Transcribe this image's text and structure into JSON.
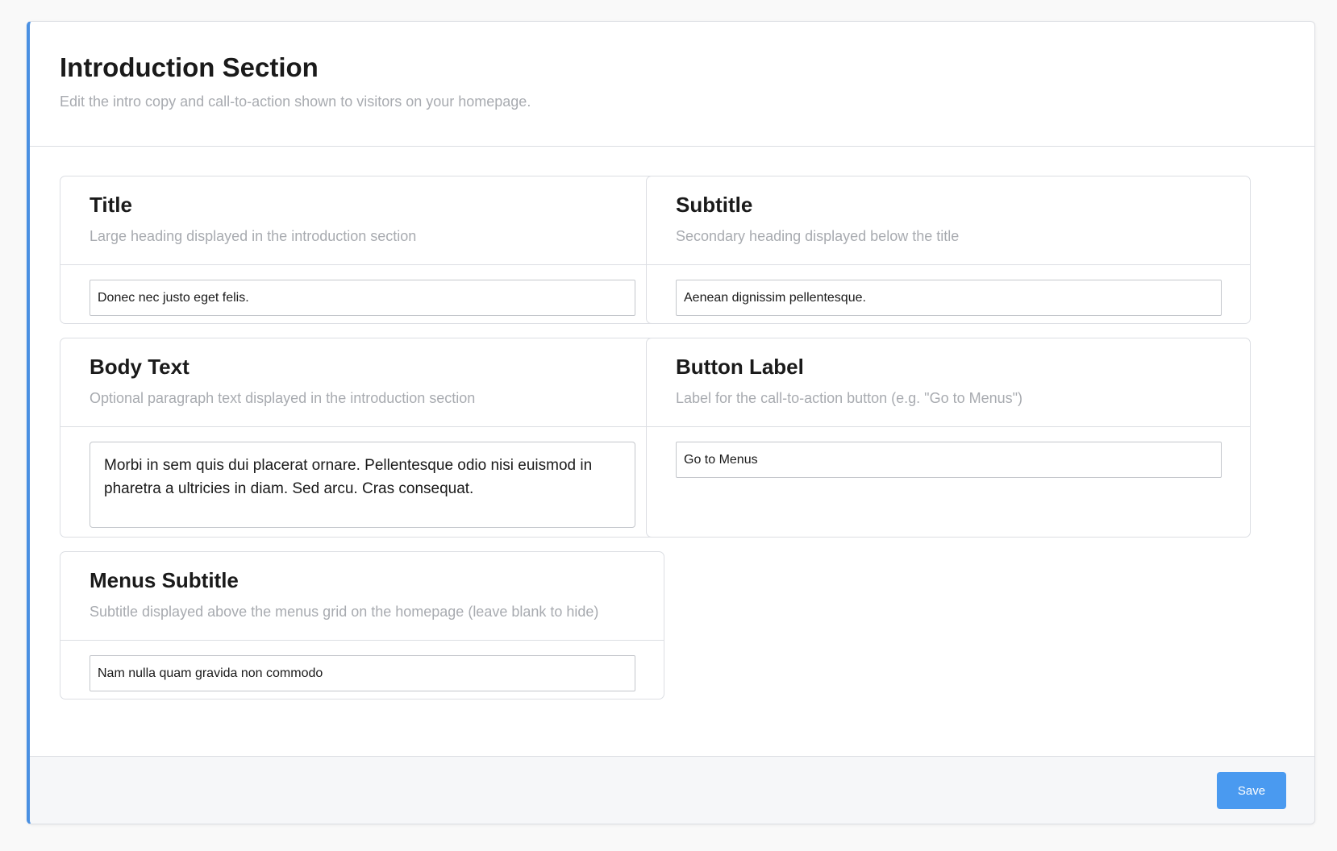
{
  "header": {
    "title": "Introduction Section",
    "description": "Edit the intro copy and call-to-action shown to visitors on your homepage."
  },
  "fields": {
    "title": {
      "label": "Title",
      "description": "Large heading displayed in the introduction section",
      "value": "Donec nec justo eget felis."
    },
    "subtitle": {
      "label": "Subtitle",
      "description": "Secondary heading displayed below the title",
      "value": "Aenean dignissim pellentesque."
    },
    "body_text": {
      "label": "Body Text",
      "description": "Optional paragraph text displayed in the introduction section",
      "value": "Morbi in sem quis dui placerat ornare. Pellentesque odio nisi euismod in pharetra a ultricies in diam. Sed arcu. Cras consequat."
    },
    "button_label": {
      "label": "Button Label",
      "description": "Label for the call-to-action button (e.g. \"Go to Menus\")",
      "value": "Go to Menus"
    },
    "menus_subtitle": {
      "label": "Menus Subtitle",
      "description": "Subtitle displayed above the menus grid on the homepage (leave blank to hide)",
      "value": "Nam nulla quam gravida non commodo"
    }
  },
  "footer": {
    "save_label": "Save"
  },
  "colors": {
    "accent": "#4a90e2",
    "button": "#4a9af0",
    "muted_text": "#a8abb0",
    "border": "#dcdee3"
  }
}
